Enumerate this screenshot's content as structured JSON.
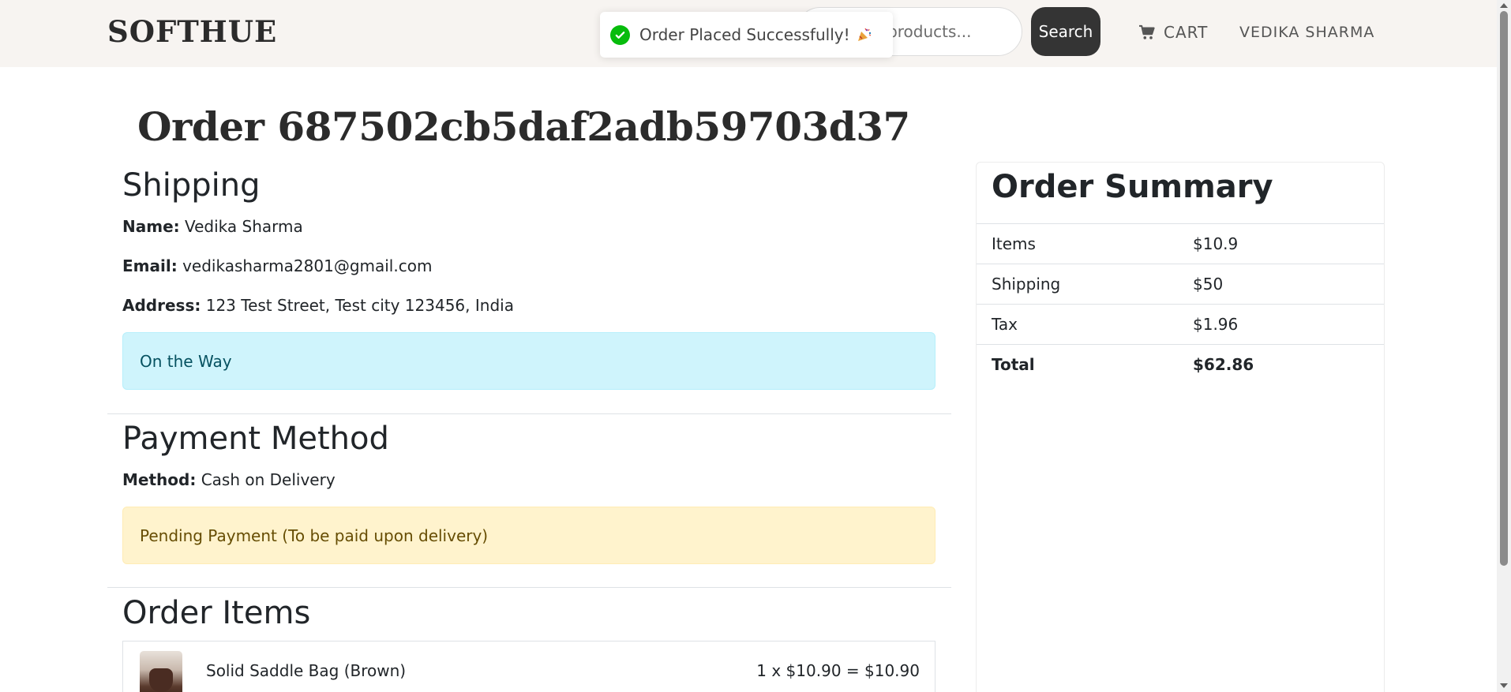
{
  "header": {
    "brand": "SOFTHUE",
    "search_placeholder": "Search products...",
    "search_button": "Search",
    "cart_label": "CART",
    "user_label": "VEDIKA SHARMA"
  },
  "toast": {
    "message": "Order Placed Successfully!",
    "icon": "check-circle-icon",
    "emoji": "party-popper-icon"
  },
  "order": {
    "title": "Order 687502cb5daf2adb59703d37"
  },
  "shipping": {
    "heading": "Shipping",
    "name_label": "Name:",
    "name": "Vedika Sharma",
    "email_label": "Email:",
    "email": "vedikasharma2801@gmail.com",
    "address_label": "Address:",
    "address": "123 Test Street, Test city 123456, India",
    "status": "On the Way"
  },
  "payment": {
    "heading": "Payment Method",
    "method_label": "Method:",
    "method": "Cash on Delivery",
    "status": "Pending Payment (To be paid upon delivery)"
  },
  "items": {
    "heading": "Order Items",
    "list": [
      {
        "name": "Solid Saddle Bag (Brown)",
        "calc": "1 x $10.90 = $10.90"
      }
    ]
  },
  "summary": {
    "title": "Order Summary",
    "rows": [
      {
        "label": "Items",
        "value": "$10.9"
      },
      {
        "label": "Shipping",
        "value": "$50"
      },
      {
        "label": "Tax",
        "value": "$1.96"
      },
      {
        "label": "Total",
        "value": "$62.86"
      }
    ]
  },
  "colors": {
    "header_bg": "#f7f4f1",
    "info_alert_bg": "#cff4fc",
    "warning_alert_bg": "#fff3cd",
    "toast_success": "#07bc0c",
    "button_dark": "#343434"
  }
}
